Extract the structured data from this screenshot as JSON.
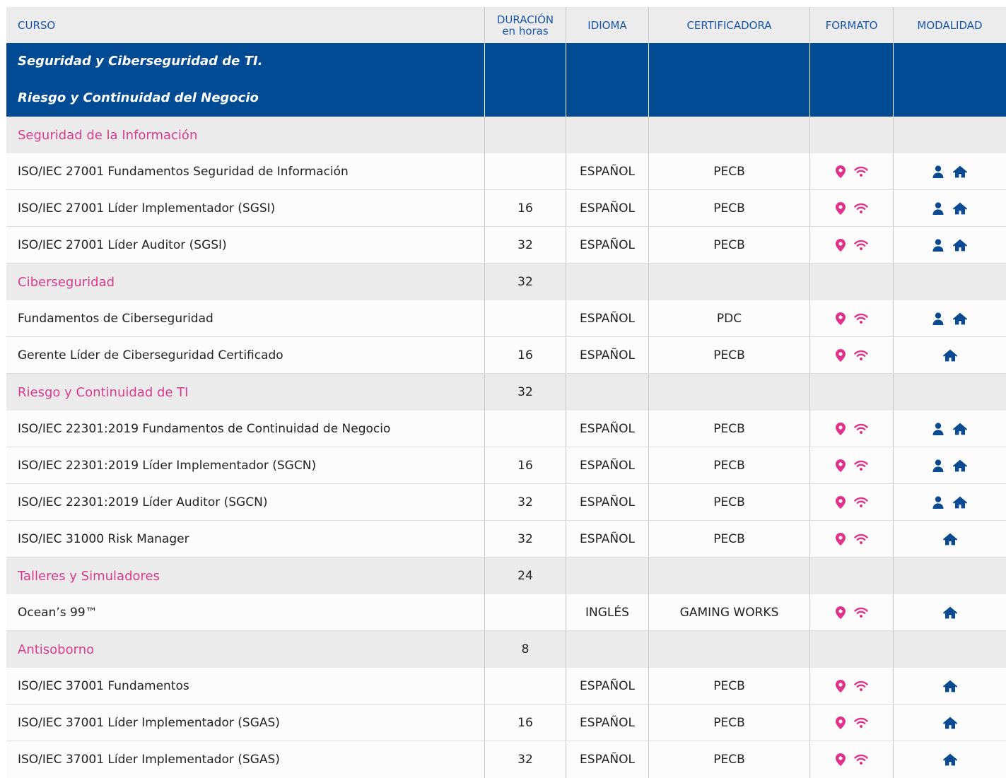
{
  "colors": {
    "accent_blue": "#004b93",
    "header_text": "#1a56a8",
    "category_pink": "#d93b8f",
    "icon_pink": "#e0328a",
    "icon_blue": "#0a4a93"
  },
  "header": {
    "curso": "CURSO",
    "duracion_line1": "DURACIÓN",
    "duracion_line2": "en horas",
    "idioma": "IDIOMA",
    "certificadora": "CERTIFICADORA",
    "formato": "FORMATO",
    "modalidad": "MODALIDAD"
  },
  "banner": {
    "line1": "Seguridad y Ciberseguridad de TI.",
    "line2": "Riesgo y Continuidad del Negocio"
  },
  "rows": [
    {
      "type": "category",
      "curso": "Seguridad de la Información",
      "duracion": ""
    },
    {
      "type": "item",
      "curso": "ISO/IEC 27001 Fundamentos  Seguridad de Información",
      "duracion": "",
      "idioma": "ESPAÑOL",
      "certificadora": "PECB",
      "formato_icons": [
        "map-pin-icon",
        "wifi-icon"
      ],
      "modalidad_icons": [
        "person-icon",
        "home-icon"
      ]
    },
    {
      "type": "item",
      "curso": "ISO/IEC 27001 Líder Implementador (SGSI)",
      "duracion": "16",
      "idioma": "ESPAÑOL",
      "certificadora": "PECB",
      "formato_icons": [
        "map-pin-icon",
        "wifi-icon"
      ],
      "modalidad_icons": [
        "person-icon",
        "home-icon"
      ]
    },
    {
      "type": "item",
      "curso": "ISO/IEC 27001 Líder Auditor (SGSI)",
      "duracion": "32",
      "idioma": "ESPAÑOL",
      "certificadora": "PECB",
      "formato_icons": [
        "map-pin-icon",
        "wifi-icon"
      ],
      "modalidad_icons": [
        "person-icon",
        "home-icon"
      ]
    },
    {
      "type": "category",
      "curso": "Ciberseguridad",
      "duracion": "32"
    },
    {
      "type": "item",
      "curso": "Fundamentos de Ciberseguridad",
      "duracion": "",
      "idioma": "ESPAÑOL",
      "certificadora": "PDC",
      "formato_icons": [
        "map-pin-icon",
        "wifi-icon"
      ],
      "modalidad_icons": [
        "person-icon",
        "home-icon"
      ]
    },
    {
      "type": "item",
      "curso": "Gerente Líder de Ciberseguridad Certificado",
      "duracion": "16",
      "idioma": "ESPAÑOL",
      "certificadora": "PECB",
      "formato_icons": [
        "map-pin-icon",
        "wifi-icon"
      ],
      "modalidad_icons": [
        "home-icon"
      ]
    },
    {
      "type": "category",
      "curso": "Riesgo y Continuidad de TI",
      "duracion": "32"
    },
    {
      "type": "item",
      "curso": "ISO/IEC 22301:2019  Fundamentos de Continuidad de Negocio",
      "duracion": "",
      "idioma": "ESPAÑOL",
      "certificadora": "PECB",
      "formato_icons": [
        "map-pin-icon",
        "wifi-icon"
      ],
      "modalidad_icons": [
        "person-icon",
        "home-icon"
      ]
    },
    {
      "type": "item",
      "curso": "ISO/IEC 22301:2019 Líder Implementador  (SGCN)",
      "duracion": "16",
      "idioma": "ESPAÑOL",
      "certificadora": "PECB",
      "formato_icons": [
        "map-pin-icon",
        "wifi-icon"
      ],
      "modalidad_icons": [
        "person-icon",
        "home-icon"
      ]
    },
    {
      "type": "item",
      "curso": "ISO/IEC 22301:2019 Líder Auditor (SGCN)",
      "duracion": "32",
      "idioma": "ESPAÑOL",
      "certificadora": "PECB",
      "formato_icons": [
        "map-pin-icon",
        "wifi-icon"
      ],
      "modalidad_icons": [
        "person-icon",
        "home-icon"
      ]
    },
    {
      "type": "item",
      "curso": "ISO/IEC 31000 Risk Manager",
      "duracion": "32",
      "idioma": "ESPAÑOL",
      "certificadora": "PECB",
      "formato_icons": [
        "map-pin-icon",
        "wifi-icon"
      ],
      "modalidad_icons": [
        "home-icon"
      ]
    },
    {
      "type": "category",
      "curso": "Talleres y Simuladores",
      "duracion": "24"
    },
    {
      "type": "item",
      "curso": "Ocean’s 99™",
      "duracion": "",
      "idioma": "INGLÉS",
      "certificadora": "GAMING WORKS",
      "formato_icons": [
        "map-pin-icon",
        "wifi-icon"
      ],
      "modalidad_icons": [
        "home-icon"
      ]
    },
    {
      "type": "category",
      "curso": "Antisoborno",
      "duracion": "8"
    },
    {
      "type": "item",
      "curso": "ISO/IEC 37001 Fundamentos",
      "duracion": "",
      "idioma": "ESPAÑOL",
      "certificadora": "PECB",
      "formato_icons": [
        "map-pin-icon",
        "wifi-icon"
      ],
      "modalidad_icons": [
        "home-icon"
      ]
    },
    {
      "type": "item",
      "curso": "ISO/IEC 37001 Líder Implementador (SGAS)",
      "duracion": "16",
      "idioma": "ESPAÑOL",
      "certificadora": "PECB",
      "formato_icons": [
        "map-pin-icon",
        "wifi-icon"
      ],
      "modalidad_icons": [
        "home-icon"
      ]
    },
    {
      "type": "item",
      "curso": "ISO/IEC 37001 Líder Implementador (SGAS)",
      "duracion": "32",
      "idioma": "ESPAÑOL",
      "certificadora": "PECB",
      "formato_icons": [
        "map-pin-icon",
        "wifi-icon"
      ],
      "modalidad_icons": [
        "home-icon"
      ]
    }
  ]
}
